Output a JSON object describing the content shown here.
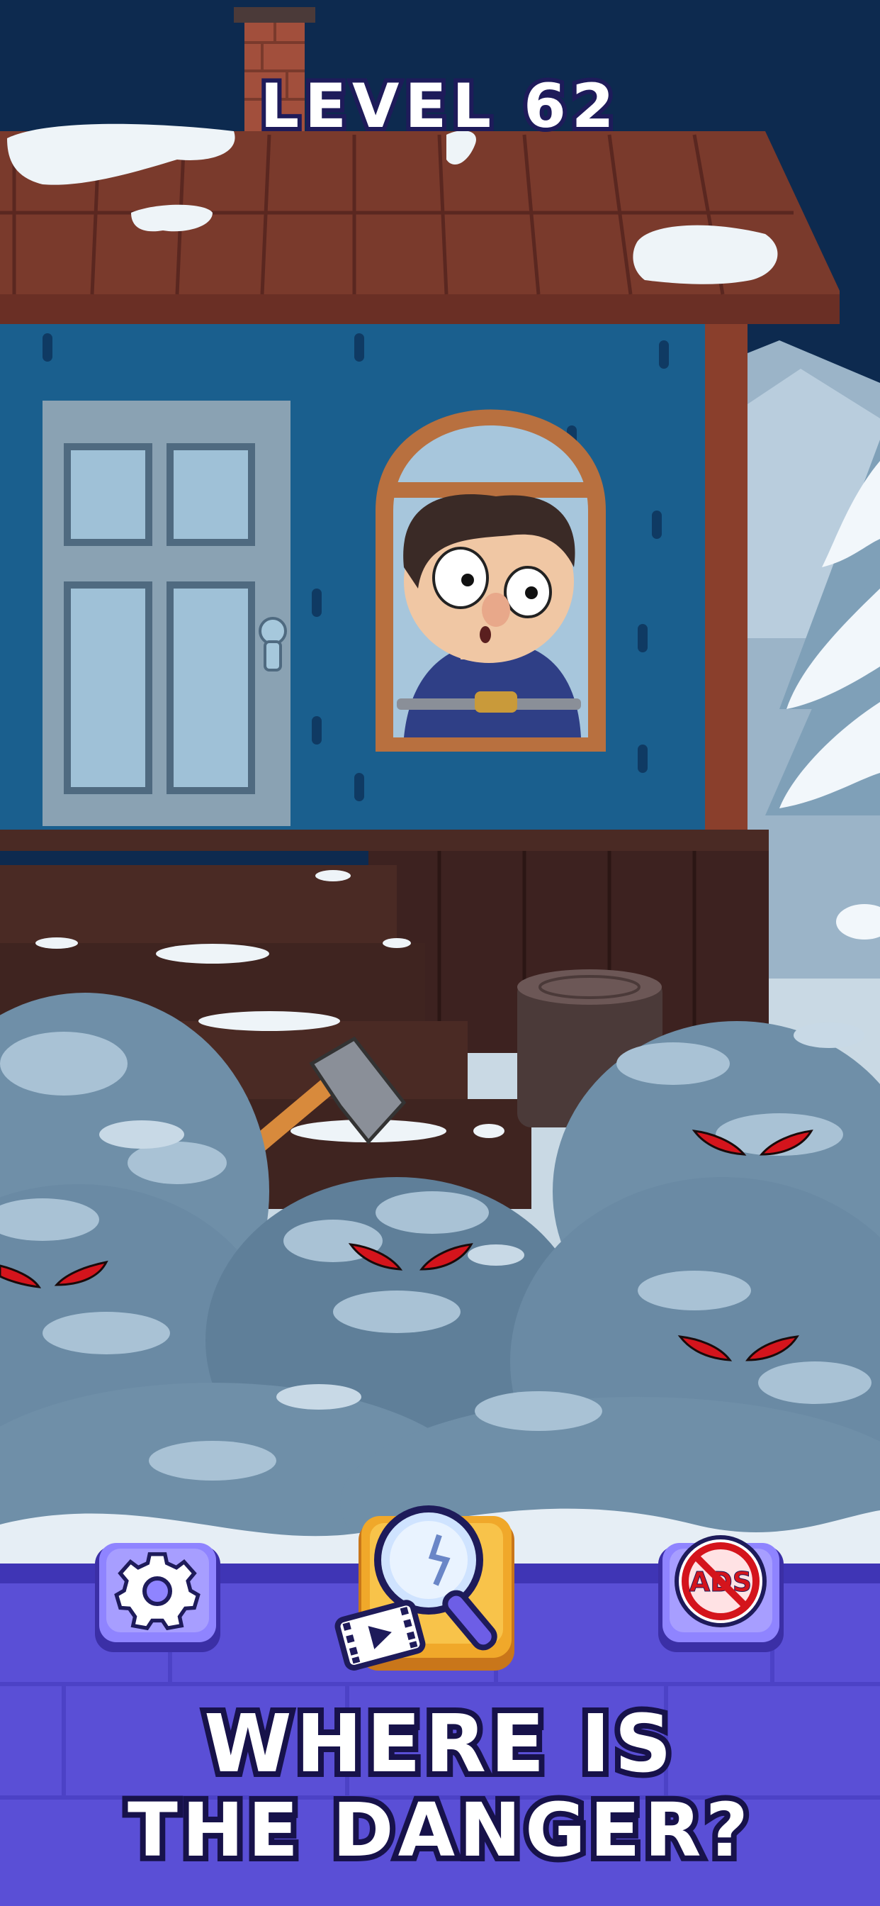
{
  "level": {
    "label": "LEVEL 62"
  },
  "hud": {
    "settings_icon": "gear-icon",
    "hint_icon": "magnifier-video-icon",
    "no_ads_label": "ADS",
    "no_ads_icon": "no-ads-icon"
  },
  "prompt": {
    "line1": "WHERE IS",
    "line2": "THE DANGER?"
  },
  "colors": {
    "sky": "#0d2a4f",
    "house_wall": "#1a5f8e",
    "roof": "#7a3a2c",
    "hud_bar": "#5a4fd6",
    "hint_button": "#f0a82a",
    "danger_eyes": "#d4141c"
  }
}
